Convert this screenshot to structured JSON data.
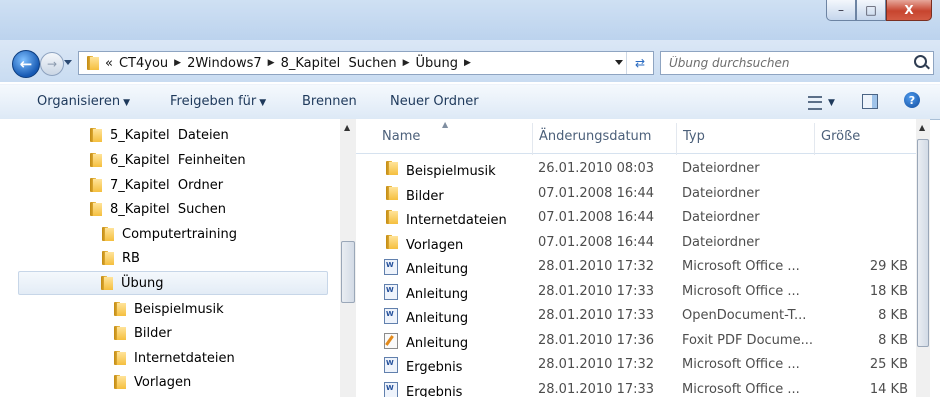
{
  "window": {
    "title_buttons": {
      "minimize": "–",
      "maximize": "□",
      "close": "X"
    }
  },
  "nav": {
    "back_icon": "back-arrow-icon",
    "forward_icon": "forward-arrow-icon"
  },
  "address": {
    "overflow": "«",
    "crumbs": [
      "CT4you",
      "2Windows7",
      "8_Kapitel  Suchen",
      "Übung"
    ],
    "separator": "▶"
  },
  "search": {
    "placeholder": "Übung durchsuchen"
  },
  "toolbar": {
    "organize": "Organisieren",
    "share": "Freigeben für",
    "burn": "Brennen",
    "new_folder": "Neuer Ordner",
    "dropdown_glyph": "▼"
  },
  "sidebar": {
    "items": [
      {
        "label": "5_Kapitel  Dateien"
      },
      {
        "label": "6_Kapitel  Feinheiten"
      },
      {
        "label": "7_Kapitel  Ordner"
      },
      {
        "label": "8_Kapitel  Suchen"
      },
      {
        "label": "Computertraining"
      },
      {
        "label": "RB"
      },
      {
        "label": "Übung"
      },
      {
        "label": "Beispielmusik"
      },
      {
        "label": "Bilder"
      },
      {
        "label": "Internetdateien"
      },
      {
        "label": "Vorlagen"
      }
    ]
  },
  "columns": {
    "name": "Name",
    "modified": "Änderungsdatum",
    "type": "Typ",
    "size": "Größe"
  },
  "files": [
    {
      "name": "Beispielmusik",
      "modified": "26.01.2010 08:03",
      "type": "Dateiordner",
      "size": "",
      "icon": "folder-icon"
    },
    {
      "name": "Bilder",
      "modified": "07.01.2008 16:44",
      "type": "Dateiordner",
      "size": "",
      "icon": "folder-icon"
    },
    {
      "name": "Internetdateien",
      "modified": "07.01.2008 16:44",
      "type": "Dateiordner",
      "size": "",
      "icon": "folder-icon"
    },
    {
      "name": "Vorlagen",
      "modified": "07.01.2008 16:44",
      "type": "Dateiordner",
      "size": "",
      "icon": "folder-icon"
    },
    {
      "name": "Anleitung",
      "modified": "28.01.2010 17:32",
      "type": "Microsoft Office ...",
      "size": "29 KB",
      "icon": "word-document-icon"
    },
    {
      "name": "Anleitung",
      "modified": "28.01.2010 17:33",
      "type": "Microsoft Office ...",
      "size": "18 KB",
      "icon": "word-document-icon"
    },
    {
      "name": "Anleitung",
      "modified": "28.01.2010 17:33",
      "type": "OpenDocument-T...",
      "size": "8 KB",
      "icon": "word-document-icon"
    },
    {
      "name": "Anleitung",
      "modified": "28.01.2010 17:36",
      "type": "Foxit PDF Docume...",
      "size": "8 KB",
      "icon": "pdf-document-icon"
    },
    {
      "name": "Ergebnis",
      "modified": "28.01.2010 17:32",
      "type": "Microsoft Office ...",
      "size": "25 KB",
      "icon": "word-document-icon"
    },
    {
      "name": "Ergebnis",
      "modified": "28.01.2010 17:33",
      "type": "Microsoft Office ...",
      "size": "14 KB",
      "icon": "word-document-icon"
    }
  ]
}
